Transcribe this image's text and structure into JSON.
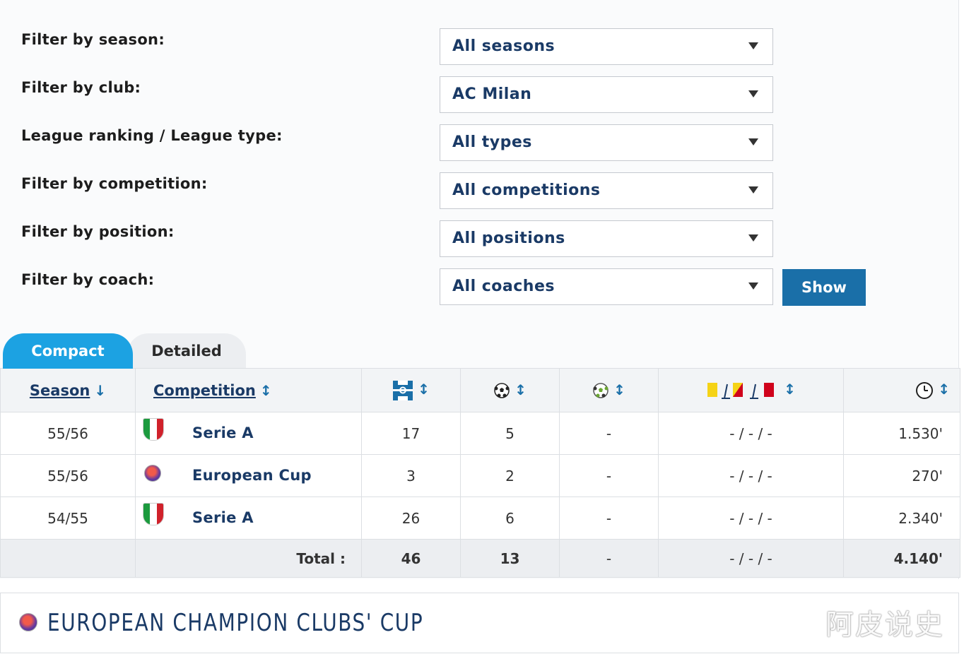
{
  "filters": [
    {
      "label": "Filter by season:",
      "value": "All seasons"
    },
    {
      "label": "Filter by club:",
      "value": "AC Milan"
    },
    {
      "label": "League ranking / League type:",
      "value": "All types"
    },
    {
      "label": "Filter by competition:",
      "value": "All competitions"
    },
    {
      "label": "Filter by position:",
      "value": "All positions"
    },
    {
      "label": "Filter by coach:",
      "value": "All coaches"
    }
  ],
  "show_button": "Show",
  "tabs": {
    "compact": "Compact",
    "detailed": "Detailed",
    "active": "compact"
  },
  "table": {
    "headers": {
      "season": "Season",
      "competition": "Competition",
      "season_sort": "↓",
      "sort": "↕"
    },
    "header_icons": [
      "appearances-icon",
      "goals-icon",
      "assists-icon",
      "cards-icon",
      "minutes-icon"
    ],
    "rows": [
      {
        "season": "55/56",
        "competition": "Serie A",
        "logo": "italy-flag-icon",
        "apps": "17",
        "goals": "5",
        "assists": "-",
        "cards": "- / - / -",
        "minutes": "1.530'"
      },
      {
        "season": "55/56",
        "competition": "European Cup",
        "logo": "european-cup-icon",
        "apps": "3",
        "goals": "2",
        "assists": "-",
        "cards": "- / - / -",
        "minutes": "270'"
      },
      {
        "season": "54/55",
        "competition": "Serie A",
        "logo": "italy-flag-icon",
        "apps": "26",
        "goals": "6",
        "assists": "-",
        "cards": "- / - / -",
        "minutes": "2.340'"
      }
    ],
    "total": {
      "label": "Total :",
      "apps": "46",
      "goals": "13",
      "assists": "-",
      "cards": "- / - / -",
      "minutes": "4.140'"
    }
  },
  "section_title": "EUROPEAN CHAMPION CLUBS' CUP",
  "watermark": "阿皮说史",
  "colors": {
    "accent": "#1ca2e2",
    "button": "#1a6fa8",
    "link": "#1a3a66"
  }
}
